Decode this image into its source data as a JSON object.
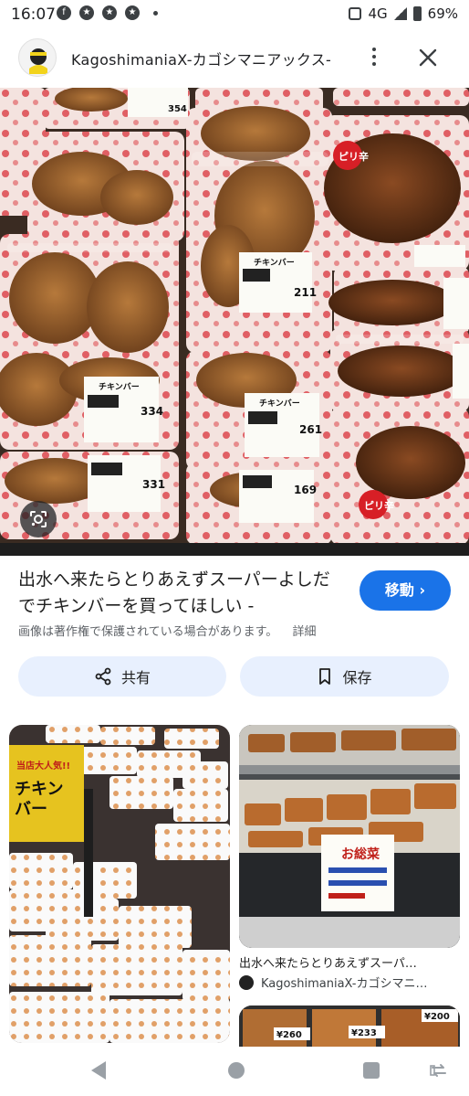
{
  "status_bar": {
    "time": "16:07",
    "network": "4G",
    "battery": "69%"
  },
  "header": {
    "site_name": "KagoshimaniaX-カゴシマニアックス-",
    "more_icon": "more-vert-icon",
    "close_icon": "close-icon"
  },
  "main_image": {
    "alt_icon": "google-lens-icon",
    "labels": {
      "product": "チキンバー",
      "price_1": "354",
      "price_2": "334",
      "price_3": "331",
      "price_4": "211",
      "price_5": "261",
      "price_6": "169",
      "spicy": "ピリ辛"
    }
  },
  "result": {
    "title": "出水へ来たらとりあえずスーパーよしだでチキンバーを買ってほしい -",
    "visit_label": "移動",
    "copyright": "画像は著作権で保護されている場合があります。",
    "details_label": "詳細"
  },
  "actions": {
    "share_label": "共有",
    "save_label": "保存"
  },
  "related": {
    "left_image_text": "当店大人気!! チキンバー",
    "right_image_text": "お総菜",
    "caption": "出水へ来たらとりあえずスーパ…",
    "source": "KagoshimaniaX-カゴシマニ…",
    "price_tags": [
      "¥260",
      "¥233",
      "¥200"
    ]
  },
  "colors": {
    "accent": "#1a73e8",
    "pill_bg": "#e8f0fe"
  }
}
